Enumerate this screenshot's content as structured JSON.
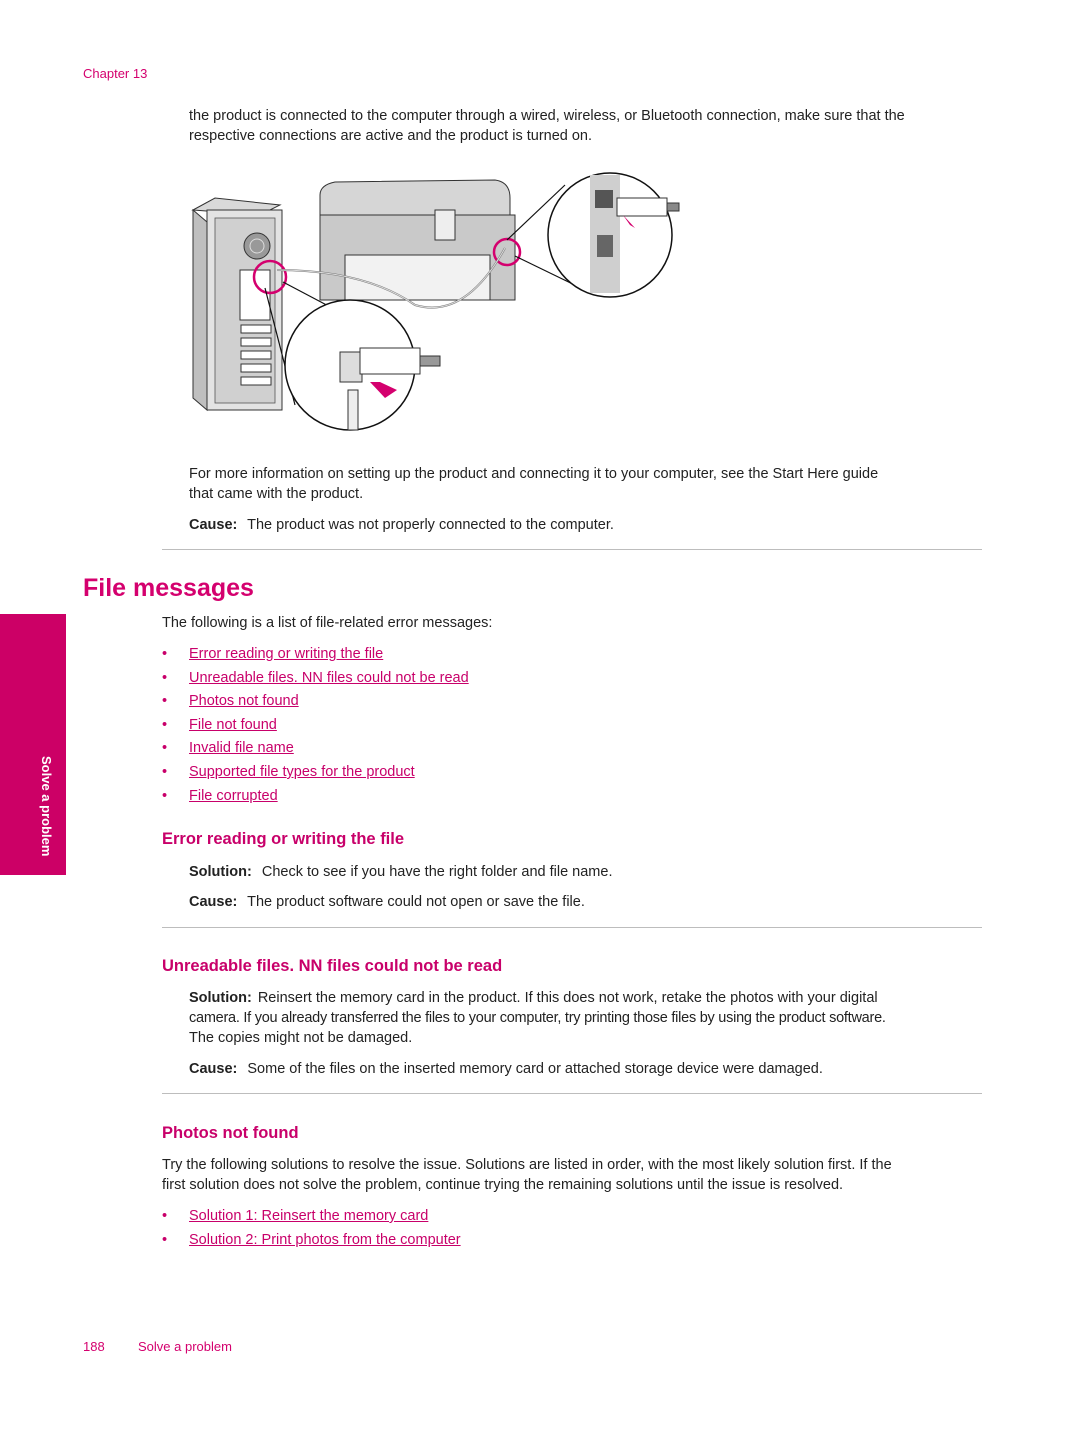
{
  "header": {
    "chapter": "Chapter 13"
  },
  "intro": {
    "line1": "the product is connected to the computer through a wired, wireless, or Bluetooth connection, make sure that the",
    "line2": "respective connections are active and the product is turned on."
  },
  "figure": {
    "description": "USB cable connection between computer and product",
    "accent_color": "#d4006e"
  },
  "more_info": {
    "line1": "For more information on setting up the product and connecting it to your computer, see the Start Here guide",
    "line2": "that came with the product."
  },
  "cause1": {
    "label": "Cause:",
    "text": "The product was not properly connected to the computer."
  },
  "section_title": "File messages",
  "list_intro": "The following is a list of file-related error messages:",
  "links": [
    {
      "bullet": "•",
      "label": "Error reading or writing the file"
    },
    {
      "bullet": "•",
      "label": "Unreadable files. NN files could not be read"
    },
    {
      "bullet": "•",
      "label": "Photos not found"
    },
    {
      "bullet": "•",
      "label": "File not found"
    },
    {
      "bullet": "•",
      "label": "Invalid file name"
    },
    {
      "bullet": "•",
      "label": "Supported file types for the product"
    },
    {
      "bullet": "•",
      "label": "File corrupted"
    }
  ],
  "side_tab": {
    "label": "Solve a problem",
    "color": "#cc0066"
  },
  "err_read": {
    "title": "Error reading or writing the file",
    "solution_label": "Solution:",
    "solution": "Check to see if you have the right folder and file name.",
    "cause_label": "Cause:",
    "cause": "The product software could not open or save the file."
  },
  "unreadable": {
    "title": "Unreadable files. NN files could not be read",
    "solution_label": "Solution:",
    "solution_l1": "Reinsert the memory card in the product. If this does not work, retake the photos with your digital",
    "solution_l2": "camera. If you already transferred the files to your computer, try printing those files by using the product software.",
    "solution_l3": "The copies might not be damaged.",
    "cause_label": "Cause:",
    "cause": "Some of the files on the inserted memory card or attached storage device were damaged."
  },
  "photos": {
    "title": "Photos not found",
    "text_l1": "Try the following solutions to resolve the issue. Solutions are listed in order, with the most likely solution first. If the",
    "text_l2": "first solution does not solve the problem, continue trying the remaining solutions until the issue is resolved.",
    "links": [
      {
        "bullet": "•",
        "label": "Solution 1: Reinsert the memory card"
      },
      {
        "bullet": "•",
        "label": "Solution 2: Print photos from the computer"
      }
    ]
  },
  "footer": {
    "page": "188",
    "section": "Solve a problem"
  }
}
